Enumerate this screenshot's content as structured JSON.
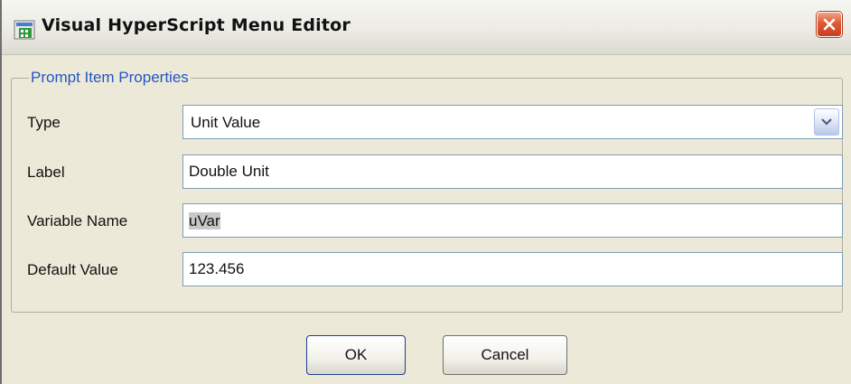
{
  "window": {
    "title": "Visual HyperScript Menu Editor",
    "icons": {
      "app": "app-icon",
      "close": "close-icon"
    }
  },
  "group": {
    "legend": "Prompt Item Properties",
    "legend_color": "#2456c2"
  },
  "fields": {
    "type": {
      "label": "Type",
      "value": "Unit Value",
      "icon": "chevron-down-icon"
    },
    "label": {
      "label": "Label",
      "value": "Double Unit"
    },
    "variable_name": {
      "label": "Variable Name",
      "value": "uVar"
    },
    "default_value": {
      "label": "Default Value",
      "value": "123.456"
    }
  },
  "buttons": {
    "ok": "OK",
    "cancel": "Cancel"
  }
}
